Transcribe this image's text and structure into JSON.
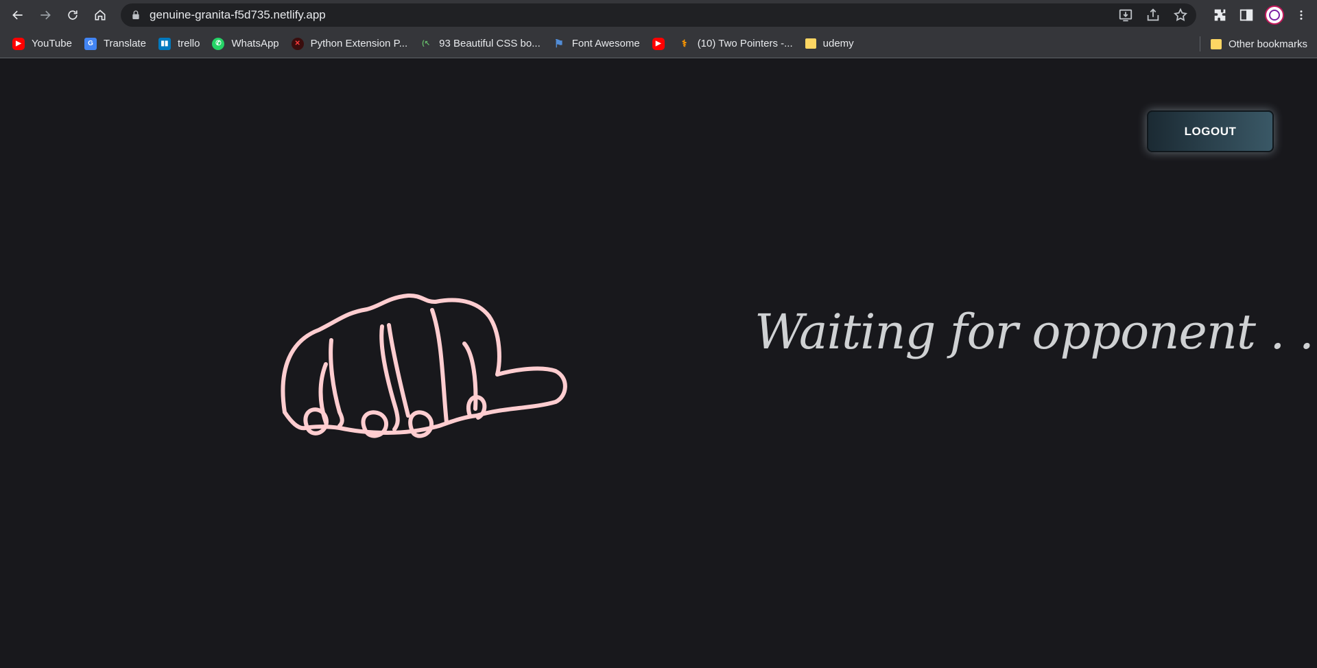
{
  "browser": {
    "url": "genuine-granita-f5d735.netlify.app",
    "bookmarks": [
      {
        "label": "YouTube",
        "icon": "youtube-icon",
        "color": "#ff0000"
      },
      {
        "label": "Translate",
        "icon": "translate-icon",
        "color": "#4285f4"
      },
      {
        "label": "trello",
        "icon": "trello-icon",
        "color": "#0079bf"
      },
      {
        "label": "WhatsApp",
        "icon": "whatsapp-icon",
        "color": "#25d366"
      },
      {
        "label": "Python Extension P...",
        "icon": "python-extension-icon",
        "color": "#b71c1c"
      },
      {
        "label": "93 Beautiful CSS bo...",
        "icon": "css-icon",
        "color": "#2e7d32"
      },
      {
        "label": "Font Awesome",
        "icon": "flag-icon",
        "color": "#528dd7"
      },
      {
        "label": "",
        "icon": "youtube-icon",
        "color": "#ff0000"
      },
      {
        "label": "(10) Two Pointers -...",
        "icon": "two-pointers-icon",
        "color": "#ff9800"
      },
      {
        "label": "udemy",
        "icon": "folder-icon",
        "color": "#fdd663"
      }
    ],
    "other_bookmarks": "Other bookmarks"
  },
  "page": {
    "logout_label": "LOGOUT",
    "status_text": "Waiting for opponent . . .",
    "hand_icon": "fist-icon",
    "hand_color": "#ffcdd0"
  }
}
